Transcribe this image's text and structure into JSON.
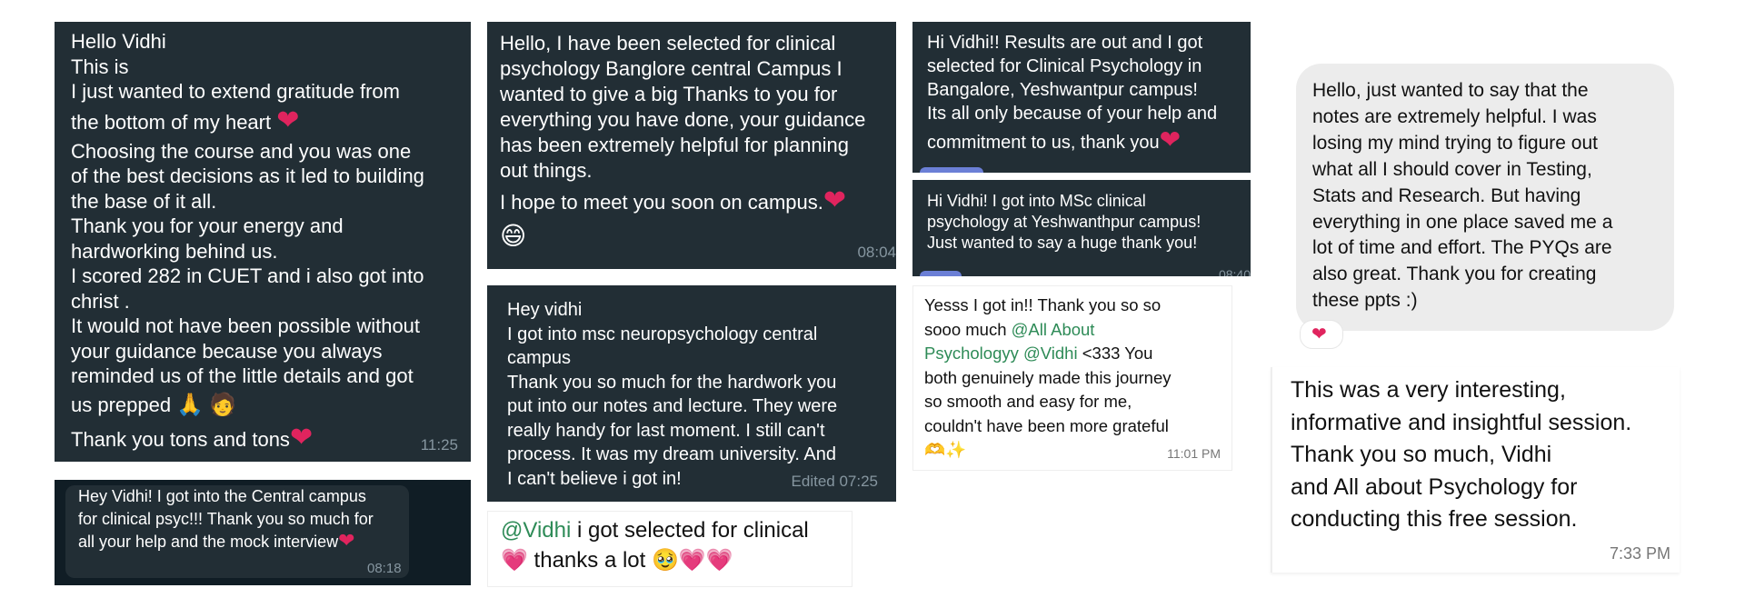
{
  "card1": {
    "lines": [
      "Hello Vidhi",
      "This is",
      "I just wanted to extend gratitude from",
      "the bottom of my heart",
      "Choosing the course and you was one",
      "of the best decisions as it led to building",
      "the base of it all.",
      "Thank you for your energy and",
      "hardworking behind us.",
      "I scored 282 in CUET and i also got into",
      "christ .",
      "It would not have been possible without",
      "your guidance because you always",
      "reminded us of the little details and got",
      "us prepped",
      "Thank you tons and tons"
    ],
    "time": "11:25"
  },
  "card2": {
    "lines": [
      "Hey Vidhi! I got into the Central campus",
      "for clinical psyc!!! Thank you so much for",
      "all your help and the mock interview"
    ],
    "time": "08:18"
  },
  "card3": {
    "lines": [
      "Hello, I have been selected for clinical",
      "psychology Banglore central Campus I",
      "wanted to give a big Thanks to you for",
      "everything you have done, your guidance",
      "has been extremely helpful for planning",
      "out things.",
      "I hope to meet you soon on campus."
    ],
    "time": "08:04"
  },
  "card4": {
    "lines": [
      "Hey vidhi",
      "I got into msc neuropsychology central",
      "campus",
      "Thank you so much for the hardwork you",
      "put into our notes and lecture. They were",
      "really handy for last moment. I still can't",
      "process. It was my dream university. And",
      "I can't believe i got in!"
    ],
    "time": "Edited 07:25"
  },
  "card5": {
    "mention": "@Vidhi",
    "text1": " i got selected for clinical",
    "text2": " thanks a lot"
  },
  "card6": {
    "lines": [
      "Hi Vidhi!! Results are out and I got",
      "selected for Clinical Psychology in",
      "Bangalore, Yeshwantpur campus!",
      "Its all only because of your help and",
      "commitment to us, thank you"
    ]
  },
  "card7": {
    "lines": [
      "Hi Vidhi! I got into MSc clinical",
      "psychology at Yeshwanthpur campus!",
      "Just wanted to say a huge thank you!"
    ],
    "time": "08:40"
  },
  "card8": {
    "line1": "Yesss I got in!! Thank you so so",
    "line2_a": "sooo much ",
    "mention1": "@All About",
    "mention1b": "Psychologyy",
    "mention2": "@Vidhi",
    "line3_b": " <333 You",
    "line4": "both genuinely made this journey",
    "line5": "so smooth and easy for me,",
    "line6": "couldn't have been more grateful",
    "time": "11:01 PM"
  },
  "card9": {
    "lines": [
      "Hello, just wanted to say that the",
      "notes are extremely helpful. I was",
      "losing my mind trying to figure out",
      "what all I should cover in Testing,",
      "Stats and Research. But having",
      "everything in one place saved me a",
      "lot of time and effort. The PYQs are",
      "also great. Thank you for creating",
      "these ppts :)"
    ]
  },
  "card10": {
    "lines": [
      "This was a very interesting,",
      "informative and insightful session.",
      "Thank you so much, Vidhi",
      "and All about Psychology for",
      "conducting this free session."
    ],
    "time": "7:33 PM"
  },
  "colors": {
    "dark_bubble": "#222e35",
    "timestamp": "#8696a0",
    "mention": "#2e8b57",
    "heart": "#e0245e",
    "gray_bubble": "#ececec"
  }
}
